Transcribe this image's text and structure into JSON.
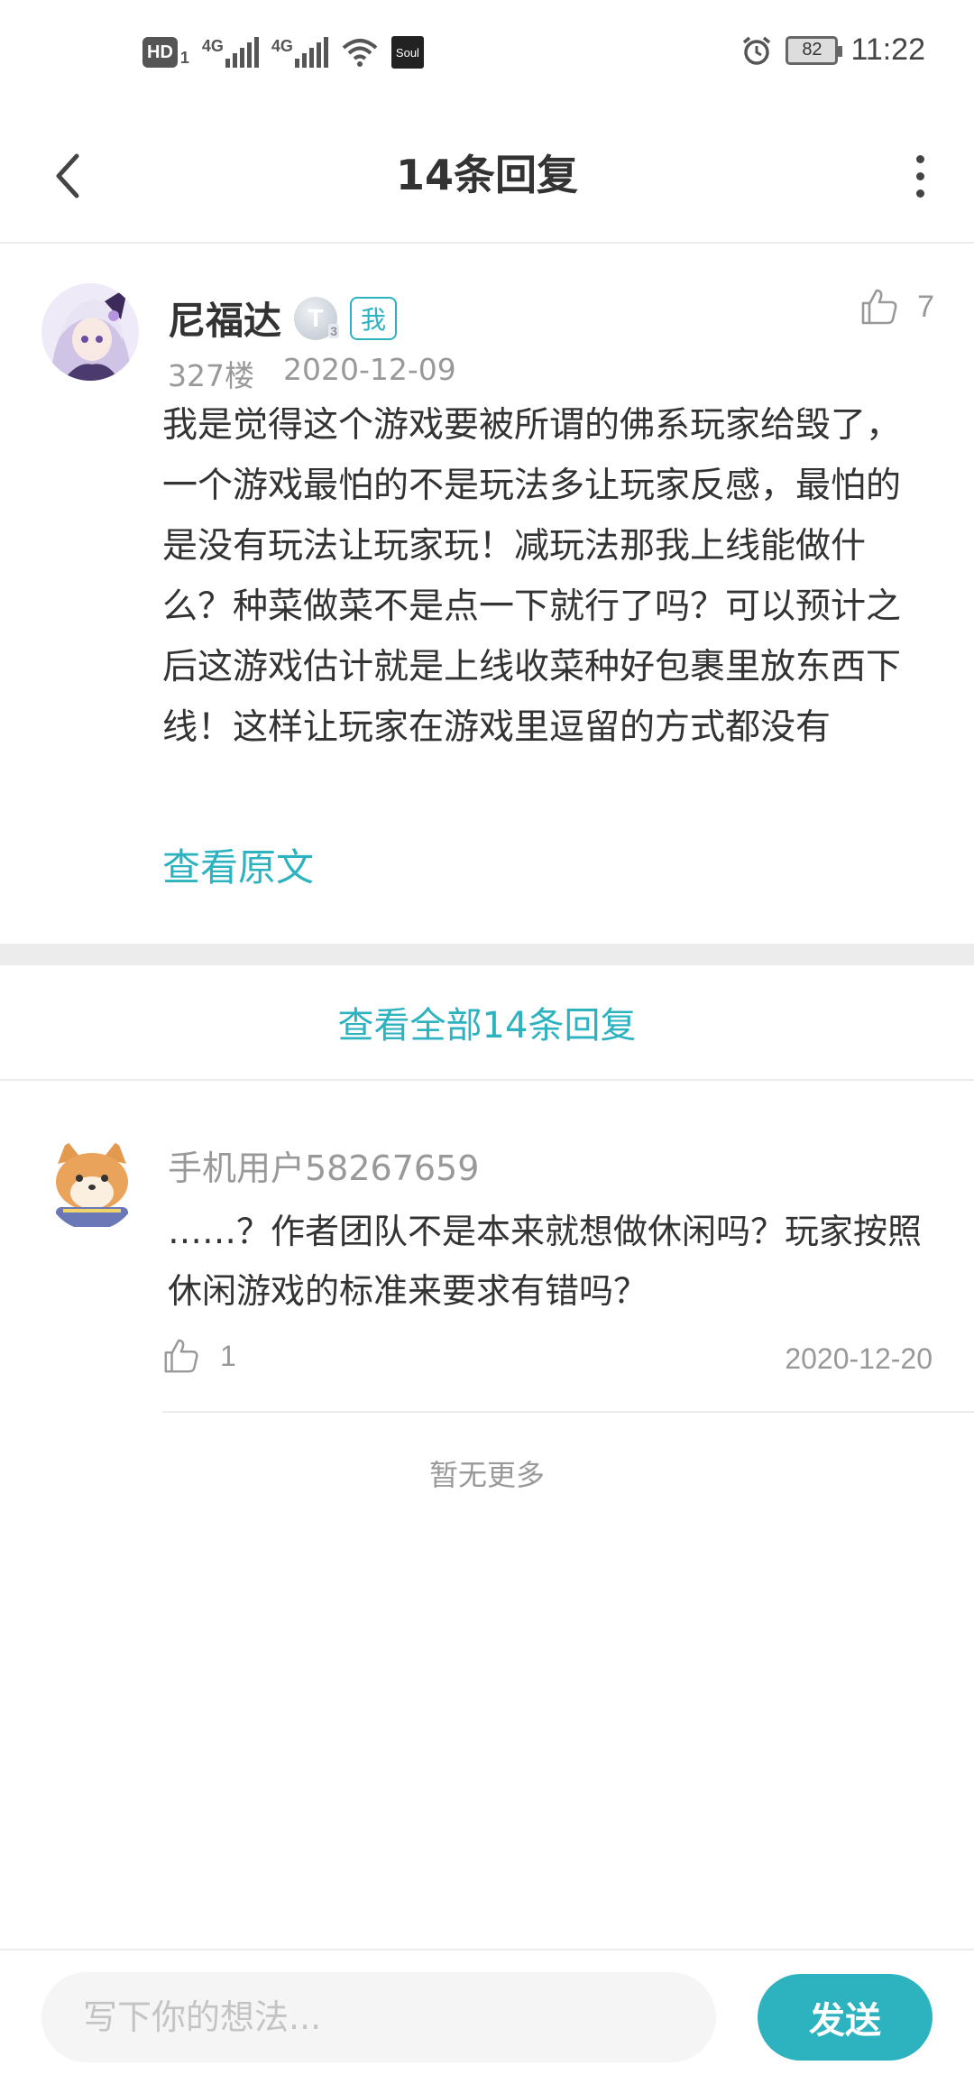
{
  "status_bar": {
    "hd_label": "HD",
    "hd_sub": "1",
    "network_1": "4G",
    "network_2": "4G",
    "app_icon_label": "Soul",
    "battery": "82",
    "time": "11:22"
  },
  "header": {
    "title": "14条回复"
  },
  "main_comment": {
    "author": "尼福达",
    "level_badge": "T",
    "level_sub": "3",
    "me_badge": "我",
    "like_count": "7",
    "floor": "327楼",
    "date": "2020-12-09",
    "body": "我是觉得这个游戏要被所谓的佛系玩家给毁了，一个游戏最怕的不是玩法多让玩家反感，最怕的是没有玩法让玩家玩！减玩法那我上线能做什么？种菜做菜不是点一下就行了吗？可以预计之后这游戏估计就是上线收菜种好包裹里放东西下线！这样让玩家在游戏里逗留的方式都没有",
    "view_original": "查看原文"
  },
  "view_all": "查看全部14条回复",
  "reply": {
    "user": "手机用户58267659",
    "body": "……？作者团队不是本来就想做休闲吗？玩家按照休闲游戏的标准来要求有错吗？",
    "like_count": "1",
    "date": "2020-12-20"
  },
  "no_more": "暂无更多",
  "bottom_bar": {
    "input_placeholder": "写下你的想法...",
    "send_label": "发送"
  },
  "colors": {
    "accent": "#2db2c0",
    "muted_text": "#999999",
    "divider": "#ececec"
  },
  "icons": [
    "back-arrow-icon",
    "more-vertical-icon",
    "thumbs-up-icon",
    "alarm-icon",
    "wifi-icon",
    "signal-icon",
    "battery-icon"
  ]
}
